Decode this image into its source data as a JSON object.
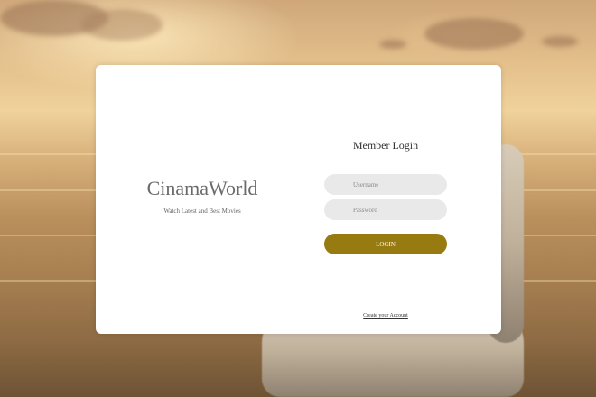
{
  "brand": {
    "title": "CinamaWorld",
    "tagline": "Watch Latest and Best Movies"
  },
  "login": {
    "title": "Member Login",
    "username_placeholder": "Username",
    "password_placeholder": "Password",
    "button_label": "LOGIN",
    "create_account_label": "Create your Account"
  },
  "colors": {
    "button": "#977a10",
    "field_background": "#e9e9e9",
    "card_background": "#ffffff"
  }
}
